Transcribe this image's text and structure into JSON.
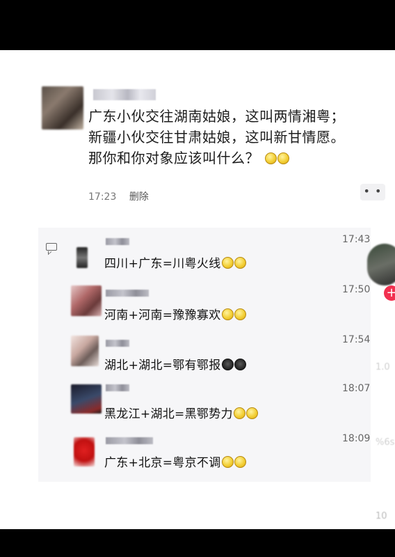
{
  "post": {
    "lines": [
      "广东小伙交往湖南姑娘，这叫两情湘粤；",
      "新疆小伙交往甘肃姑娘，这叫新甘情愿。",
      "那你和你对象应该叫什么？"
    ],
    "time": "17:23",
    "delete_label": "删除",
    "more_label": "• •"
  },
  "comments": [
    {
      "text": "四川+广东=川粤火线",
      "time": "17:43",
      "emoji": "embarrassed-emoji"
    },
    {
      "text": "河南+河南=豫豫寡欢",
      "time": "17:50",
      "emoji": "sad-emoji"
    },
    {
      "text": "湖北+湖北=鄂有鄂报",
      "time": "17:54",
      "emoji": "owl-emoji"
    },
    {
      "text": "黑龙江+湖北=黑鄂势力",
      "time": "18:07",
      "emoji": "shocked-emoji"
    },
    {
      "text": "广东+北京=粤京不调",
      "time": "18:09",
      "emoji": "embarrassed-emoji"
    }
  ],
  "side": {
    "plus_label": "+",
    "count_a": "1.0",
    "count_b": "%6s",
    "count_c": "10"
  }
}
